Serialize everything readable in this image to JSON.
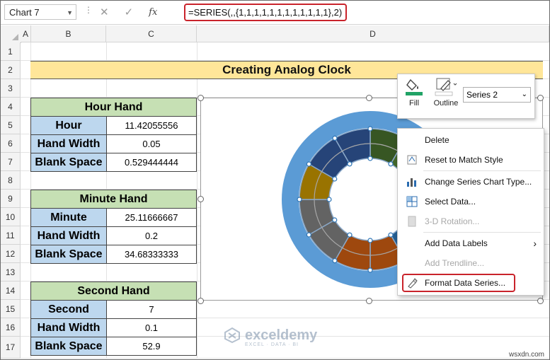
{
  "formula_bar": {
    "name_box": "Chart 7",
    "cancel_icon": "✕",
    "enter_icon": "✓",
    "fx_label": "fx",
    "formula": "=SERIES(,,{1,1,1,1,1,1,1,1,1,1,1,1},2)"
  },
  "columns": [
    "A",
    "B",
    "C",
    "D"
  ],
  "rows": [
    "1",
    "2",
    "3",
    "4",
    "5",
    "6",
    "7",
    "8",
    "9",
    "10",
    "11",
    "12",
    "13",
    "14",
    "15",
    "16",
    "17"
  ],
  "sheet": {
    "title": "Creating Analog Clock",
    "hour_table": {
      "header": "Hour Hand",
      "rows": [
        {
          "label": "Hour",
          "value": "11.42055556"
        },
        {
          "label": "Hand Width",
          "value": "0.05"
        },
        {
          "label": "Blank Space",
          "value": "0.529444444"
        }
      ]
    },
    "minute_table": {
      "header": "Minute Hand",
      "rows": [
        {
          "label": "Minute",
          "value": "25.11666667"
        },
        {
          "label": "Hand Width",
          "value": "0.2"
        },
        {
          "label": "Blank Space",
          "value": "34.68333333"
        }
      ]
    },
    "second_table": {
      "header": "Second Hand",
      "rows": [
        {
          "label": "Second",
          "value": "7"
        },
        {
          "label": "Hand Width",
          "value": "0.1"
        },
        {
          "label": "Blank Space",
          "value": "52.9"
        }
      ]
    }
  },
  "mini_toolbar": {
    "fill_label": "Fill",
    "outline_label": "Outline",
    "series_select": "Series 2",
    "fill_color": "#21a366"
  },
  "context_menu": {
    "items": [
      {
        "label": "Delete",
        "icon": "none",
        "disabled": false
      },
      {
        "label": "Reset to Match Style",
        "icon": "reset-icon",
        "disabled": false
      },
      {
        "label": "Change Series Chart Type...",
        "icon": "chart-type-icon",
        "disabled": false
      },
      {
        "label": "Select Data...",
        "icon": "select-data-icon",
        "disabled": false
      },
      {
        "label": "3-D Rotation...",
        "icon": "rotation-icon",
        "disabled": true
      },
      {
        "label": "Add Data Labels",
        "icon": "none",
        "disabled": false,
        "submenu": true
      },
      {
        "label": "Add Trendline...",
        "icon": "none",
        "disabled": true
      },
      {
        "label": "Format Data Series...",
        "icon": "format-series-icon",
        "disabled": false
      }
    ],
    "submenu_arrow": "›"
  },
  "chart": {
    "outer_ring_color": "#5b9bd5",
    "inner_colors": [
      "#375623",
      "#70ad47",
      "#255e91",
      "#9e480e",
      "#636363",
      "#997300",
      "#264478",
      "#43682b"
    ]
  },
  "watermark": {
    "name": "exceldemy",
    "tagline": "EXCEL · DATA · BI"
  },
  "footer": "wsxdn.com"
}
